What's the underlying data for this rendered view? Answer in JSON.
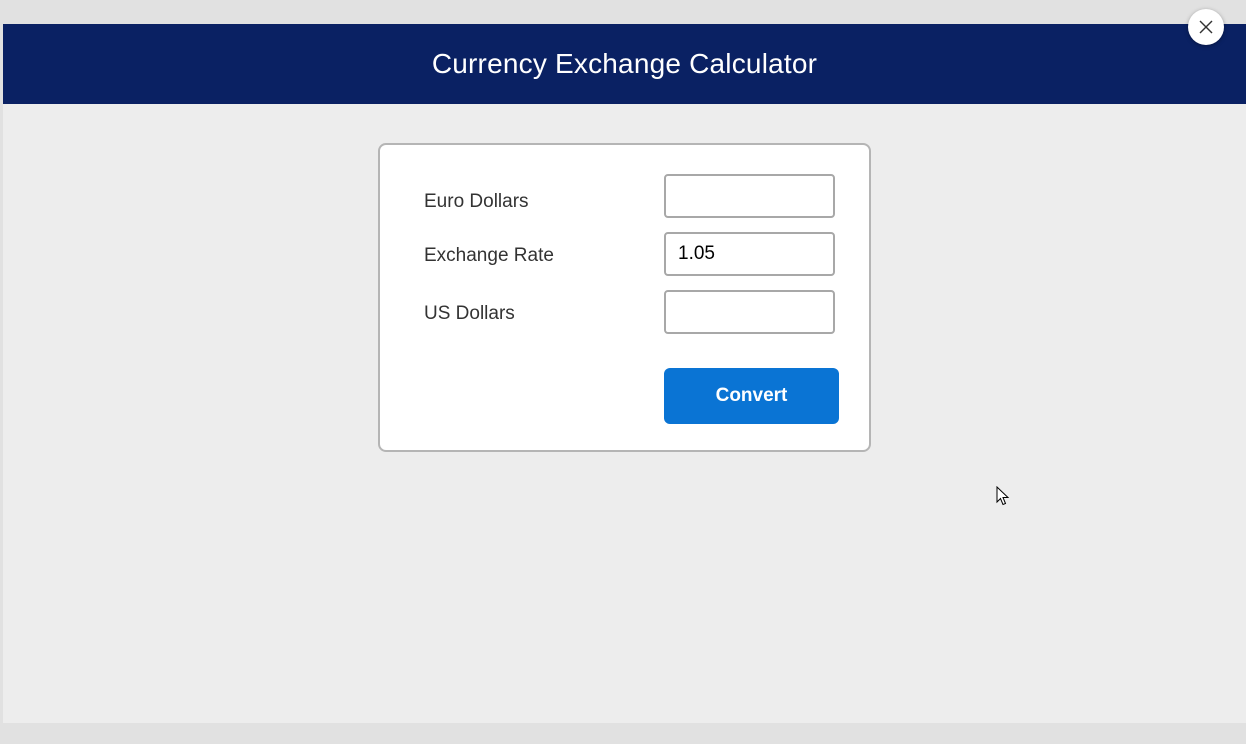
{
  "header": {
    "title": "Currency Exchange Calculator",
    "bg_color": "#0a2163",
    "close_icon": "close-icon"
  },
  "form": {
    "fields": [
      {
        "label": "Euro Dollars",
        "value": "",
        "placeholder": ""
      },
      {
        "label": "Exchange Rate",
        "value": "1.05",
        "placeholder": ""
      },
      {
        "label": "US Dollars",
        "value": "",
        "placeholder": ""
      }
    ],
    "convert_label": "Convert",
    "button_color": "#0a74d4"
  }
}
